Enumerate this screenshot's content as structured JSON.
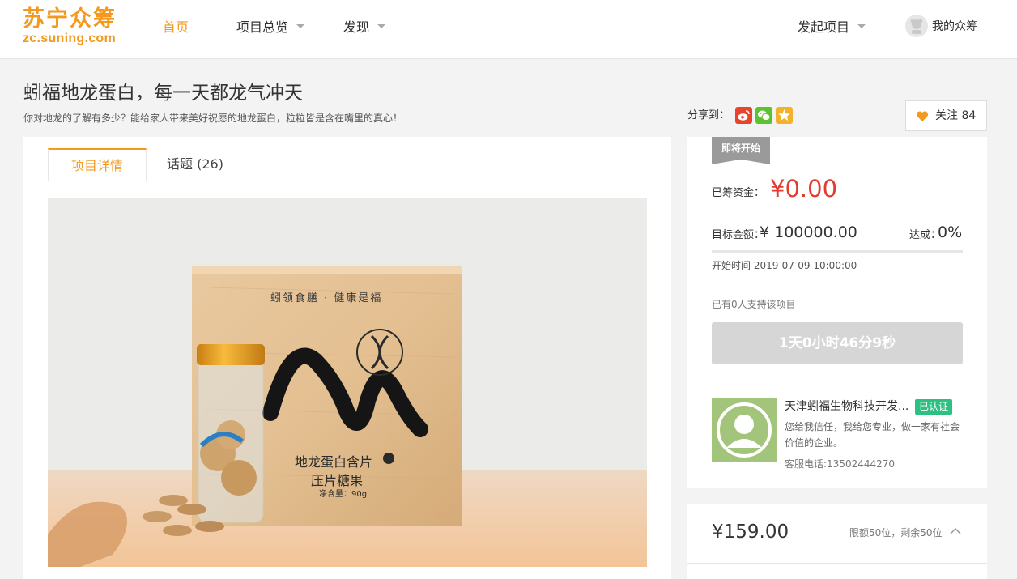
{
  "header": {
    "logo_cn": "苏宁众筹",
    "logo_en": "zc.suning.com",
    "nav": [
      {
        "label": "首页",
        "active": true
      },
      {
        "label": "项目总览",
        "dropdown": true
      },
      {
        "label": "发现",
        "dropdown": true
      }
    ],
    "launch_label": "发起项目",
    "my_crowdfunding": "我的众筹"
  },
  "project": {
    "title": "蚓福地龙蛋白，每一天都龙气冲天",
    "subtitle": "你对地龙的了解有多少？能给家人带来美好祝愿的地龙蛋白，粒粒皆是含在嘴里的真心！",
    "share_label": "分享到：",
    "share_icons": [
      "weibo-icon",
      "wechat-icon",
      "qzone-icon"
    ],
    "follow_label": "关注",
    "follow_count": "84"
  },
  "tabs": [
    {
      "label": "项目详情",
      "active": true
    },
    {
      "label": "话题 (26)",
      "active": false
    }
  ],
  "hero": {
    "box_slogan": "蚓领食膳 · 健康是福",
    "product_name_1": "地龙蛋白含片",
    "product_name_2": "压片糖果",
    "net_weight": "净含量：90g"
  },
  "funding": {
    "status_badge": "即将开始",
    "raised_label": "已筹资金：",
    "raised_value": "¥0.00",
    "target_label": "目标金额：",
    "target_value": "¥ 100000.00",
    "reach_label": "达成：",
    "reach_value": "0%",
    "progress_fraction": 0,
    "start_time": "开始时间 2019-07-09 10:00:00",
    "supporters": "已有0人支持该项目",
    "countdown": "1天0小时46分9秒"
  },
  "sponsor": {
    "name": "天津蚓福生物科技开发...",
    "verified": "已认证",
    "description": "您给我信任，我给您专业，做一家有社会价值的企业。",
    "phone": "客服电话:13502444270"
  },
  "reward": {
    "price": "¥159.00",
    "limit": "限额50位，剩余50位"
  },
  "colors": {
    "brand_orange": "#f39a1e",
    "price_red": "#e33b2f",
    "verified_green": "#2cc082"
  }
}
